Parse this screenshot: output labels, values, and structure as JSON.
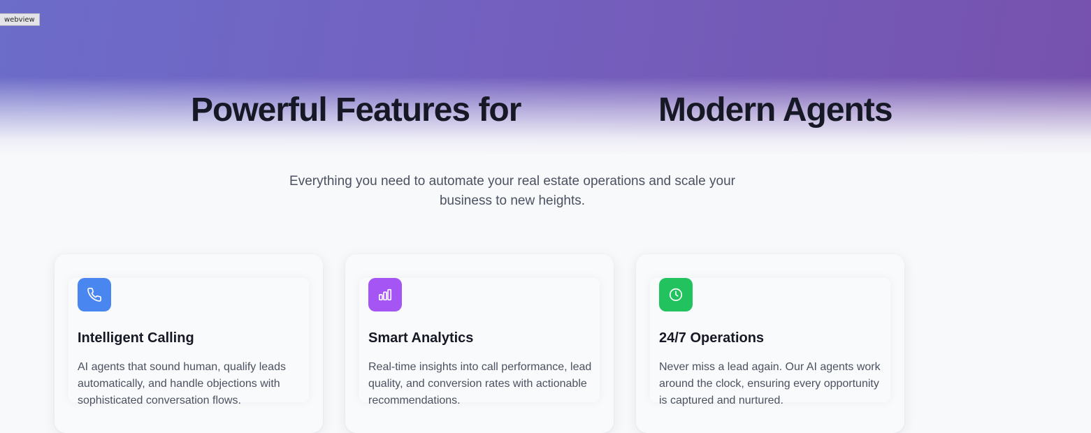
{
  "overlay": {
    "tag_label": "webview"
  },
  "hero": {
    "title_part1": "Powerful Features for",
    "title_part2": "Modern Agents",
    "subtitle": "Everything you need to automate your real estate operations and scale your business to new heights."
  },
  "features": [
    {
      "icon": "phone-icon",
      "icon_color": "#4a86f0",
      "title": "Intelligent Calling",
      "description": "AI agents that sound human, qualify leads automatically, and handle objections with sophisticated conversation flows."
    },
    {
      "icon": "bar-chart-icon",
      "icon_color": "#a455f4",
      "title": "Smart Analytics",
      "description": "Real-time insights into call performance, lead quality, and conversion rates with actionable recommendations."
    },
    {
      "icon": "clock-icon",
      "icon_color": "#22c35f",
      "title": "24/7 Operations",
      "description": "Never miss a lead again. Our AI agents work around the clock, ensuring every opportunity is captured and nurtured."
    }
  ],
  "colors": {
    "hero_gradient_start": "#6c6cc9",
    "hero_gradient_end": "#7652ad",
    "page_background": "#f8f9fb",
    "heading_text": "#161925",
    "body_text": "#4b5160"
  }
}
